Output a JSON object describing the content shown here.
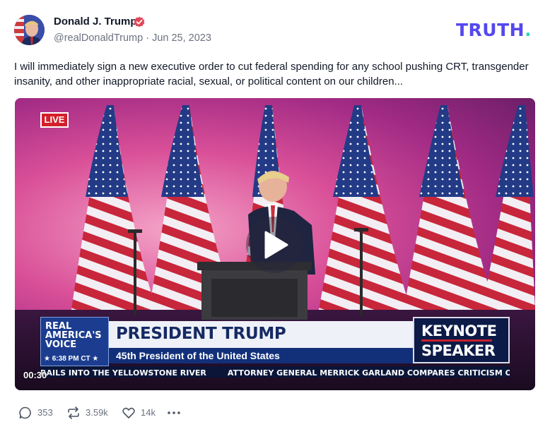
{
  "post": {
    "author_name": "Donald J. Trump",
    "handle": "@realDonaldTrump",
    "date": "Jun 25, 2023",
    "handle_line": "@realDonaldTrump · Jun 25, 2023",
    "text": "I will immediately sign a new executive order to cut federal spending for any school pushing CRT, transgender insanity, and other inappropriate racial, sexual, or political content on our children..."
  },
  "brand": {
    "logo_text": "TRUTH",
    "logo_dot": ".",
    "accent": "#5448ee",
    "dot_color": "#2dd4bf"
  },
  "video": {
    "live_badge": "LIVE",
    "network_logo_lines": [
      "REAL",
      "AMERICA'S",
      "VOICE"
    ],
    "network_time": "★ 6:38 PM CT ★",
    "headline": "PRESIDENT TRUMP",
    "subhead": "45th President of the United States",
    "keynote_line1": "KEYNOTE",
    "keynote_line2": "SPEAKER",
    "ticker_1": "RAILS INTO THE YELLOWSTONE RIVER",
    "ticker_2": "ATTORNEY GENERAL MERRICK GARLAND COMPARES CRITICISM OI",
    "timestamp": "00:30"
  },
  "actions": {
    "replies": "353",
    "retruths": "3.59k",
    "likes": "14k"
  },
  "icons": [
    "verified-icon",
    "play-icon",
    "reply-icon",
    "retruth-icon",
    "like-icon",
    "more-icon"
  ]
}
